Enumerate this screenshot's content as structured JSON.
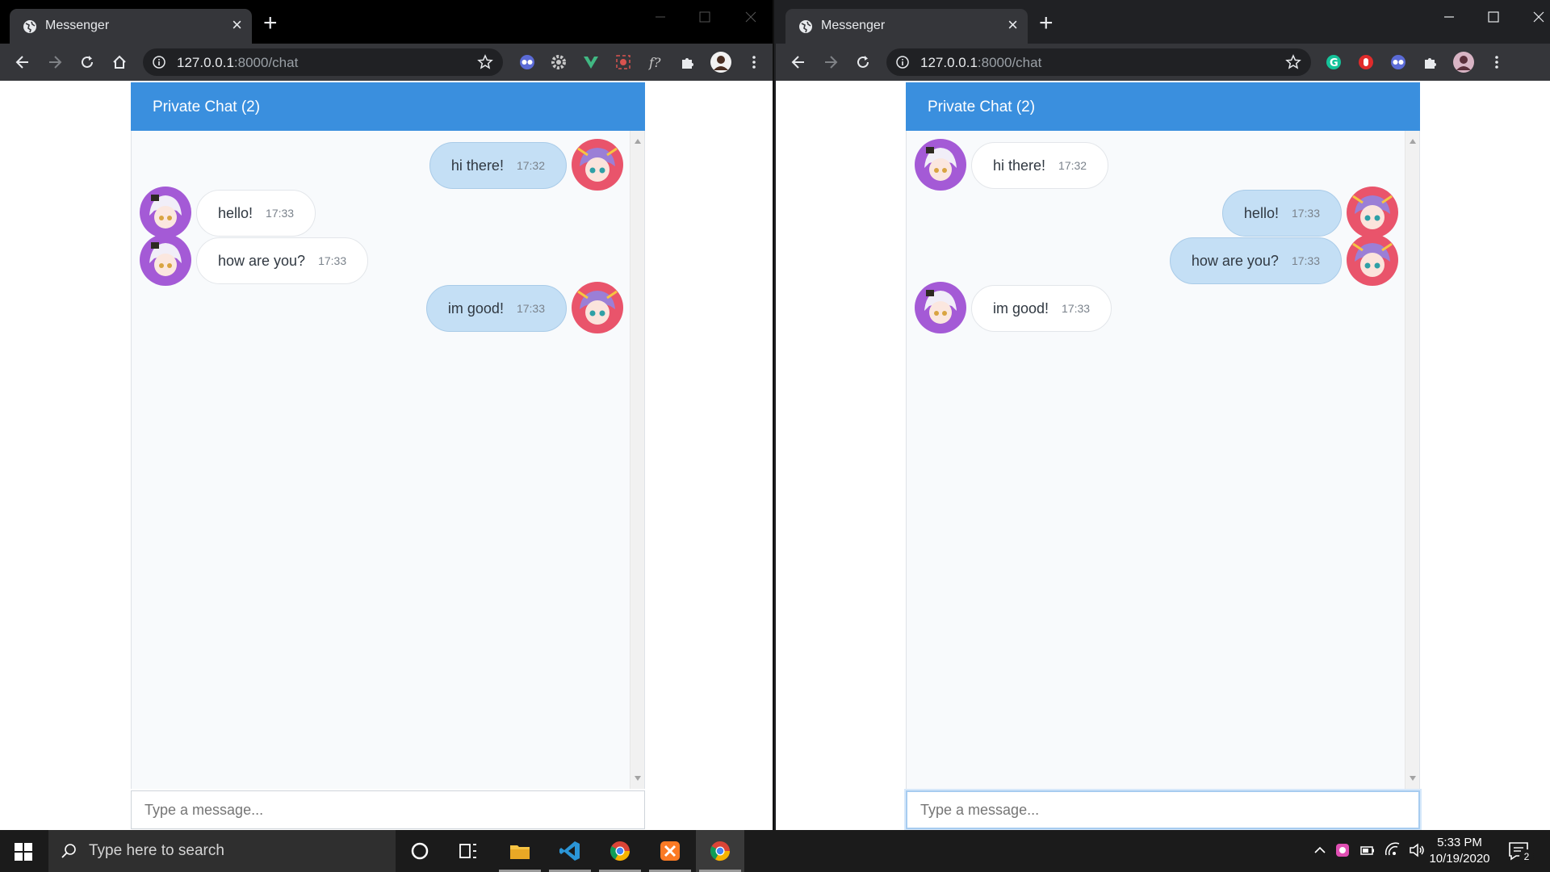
{
  "windows": [
    {
      "tab_title": "Messenger",
      "url_host": "127.0.0.1",
      "url_rest": ":8000/chat",
      "chat_title": "Private Chat (2)",
      "input_placeholder": "Type a message...",
      "messages": [
        {
          "text": "hi there!",
          "time": "17:32",
          "direction": "outgoing"
        },
        {
          "text": "hello!",
          "time": "17:33",
          "direction": "incoming"
        },
        {
          "text": "how are you?",
          "time": "17:33",
          "direction": "incoming"
        },
        {
          "text": "im good!",
          "time": "17:33",
          "direction": "outgoing"
        }
      ]
    },
    {
      "tab_title": "Messenger",
      "url_host": "127.0.0.1",
      "url_rest": ":8000/chat",
      "chat_title": "Private Chat (2)",
      "input_placeholder": "Type a message...",
      "messages": [
        {
          "text": "hi there!",
          "time": "17:32",
          "direction": "incoming"
        },
        {
          "text": "hello!",
          "time": "17:33",
          "direction": "outgoing"
        },
        {
          "text": "how are you?",
          "time": "17:33",
          "direction": "outgoing"
        },
        {
          "text": "im good!",
          "time": "17:33",
          "direction": "incoming"
        }
      ]
    }
  ],
  "taskbar": {
    "search_placeholder": "Type here to search",
    "time": "5:33 PM",
    "date": "10/19/2020",
    "notification_count": "2",
    "apps": [
      "cortana-icon",
      "task-view-icon",
      "file-explorer-icon",
      "chrome-icon",
      "vscode-icon",
      "xampp-icon",
      "chrome-icon"
    ]
  },
  "colors": {
    "chat_header": "#3a8fde",
    "outgoing_bubble": "#c4dff5",
    "incoming_bubble": "#ffffff"
  }
}
